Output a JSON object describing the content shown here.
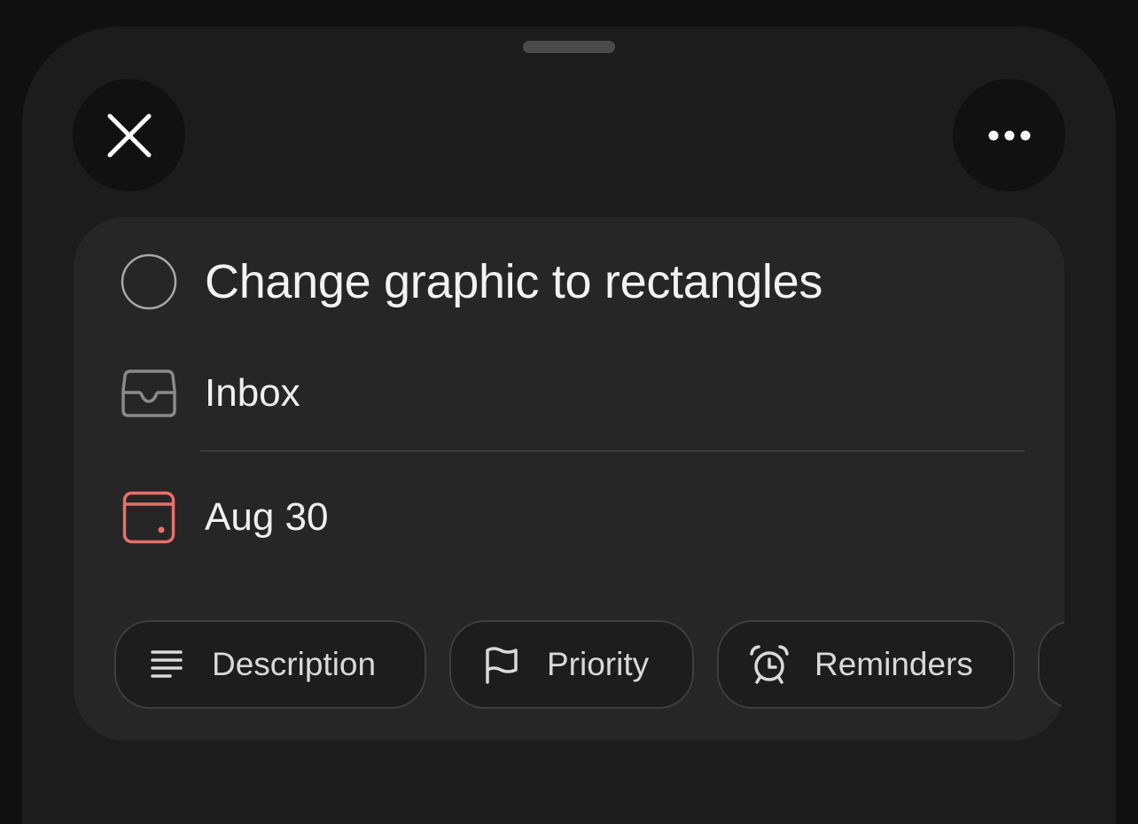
{
  "task": {
    "title": "Change graphic to rectangles",
    "project": "Inbox",
    "due_date": "Aug 30"
  },
  "chips": {
    "description_label": "Description",
    "priority_label": "Priority",
    "reminders_label": "Reminders"
  },
  "icons": {
    "close": "close-icon",
    "more": "more-horizontal-icon",
    "checkbox": "circle-checkbox-icon",
    "project": "inbox-tray-icon",
    "date": "calendar-icon",
    "description": "text-lines-icon",
    "priority": "flag-icon",
    "reminders": "alarm-clock-icon"
  },
  "colors": {
    "background": "#101010",
    "sheet": "#1c1c1c",
    "card": "#262626",
    "date_accent": "#e8706a",
    "text": "#f3f3f3",
    "muted_icon": "#8a8a8a"
  }
}
